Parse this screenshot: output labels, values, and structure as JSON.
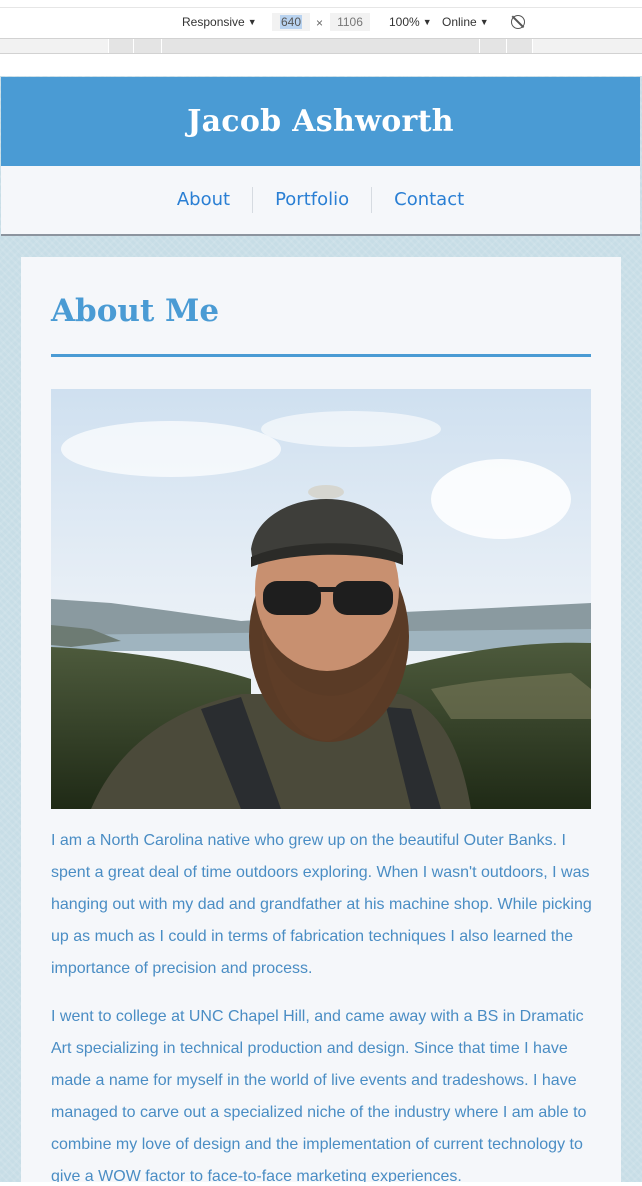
{
  "devtools": {
    "device_mode": "Responsive",
    "width": "640",
    "separator": "×",
    "height": "1106",
    "zoom": "100%",
    "throttling": "Online",
    "icons": {
      "rotate": "rotate-icon"
    }
  },
  "site": {
    "title": "Jacob Ashworth",
    "nav": [
      {
        "label": "About"
      },
      {
        "label": "Portfolio"
      },
      {
        "label": "Contact"
      }
    ]
  },
  "main": {
    "heading": "About Me",
    "bio": [
      "I am a North Carolina native who grew up on the beautiful Outer Banks. I spent a great deal of time outdoors exploring. When I wasn't outdoors, I was hanging out with my dad and grandfather at his machine shop. While picking up as much as I could in terms of fabrication techniques I also learned the importance of precision and process.",
      "I went to college at UNC Chapel Hill, and came away with a BS in Dramatic Art specializing in technical production and design. Since that time I have made a name for myself in the world of live events and tradeshows. I have managed to carve out a specialized niche of the industry where I am able to combine my love of design and the implementation of current technology to give a WOW factor to face-to-face marketing experiences."
    ]
  },
  "colors": {
    "accent": "#4a9bd4",
    "link": "#2a7fd4",
    "background": "#c7dde6",
    "card": "#f5f7fa",
    "bio_text": "#4a8dc4"
  }
}
